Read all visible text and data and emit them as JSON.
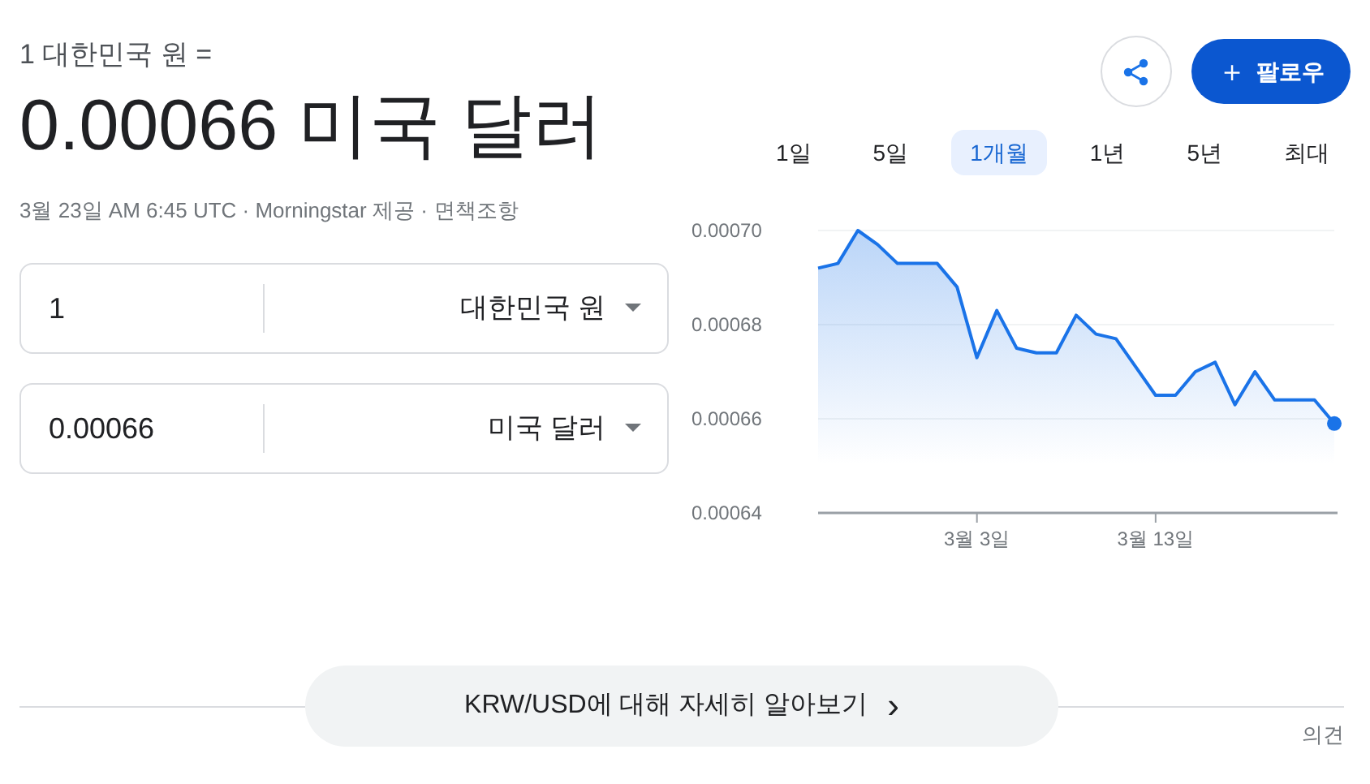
{
  "header": {
    "subtitle": "1 대한민국 원 =",
    "result": "0.00066 미국 달러",
    "meta": "3월 23일 AM 6:45 UTC · Morningstar 제공 · ",
    "disclaimer_link": "면책조항"
  },
  "follow_button": {
    "icon": "＋",
    "label": "팔로우"
  },
  "converter": [
    {
      "amount": "1",
      "currency": "대한민국 원"
    },
    {
      "amount": "0.00066",
      "currency": "미국 달러"
    }
  ],
  "range_tabs": [
    {
      "label": "1일",
      "selected": false
    },
    {
      "label": "5일",
      "selected": false
    },
    {
      "label": "1개월",
      "selected": true
    },
    {
      "label": "1년",
      "selected": false
    },
    {
      "label": "5년",
      "selected": false
    },
    {
      "label": "최대",
      "selected": false
    }
  ],
  "chart_data": {
    "type": "area",
    "categories": [
      null,
      null,
      null,
      null,
      null,
      null,
      null,
      null,
      "3월 3일",
      null,
      null,
      null,
      null,
      null,
      null,
      null,
      null,
      "3월 13일",
      null,
      null,
      null,
      null,
      null,
      null,
      null,
      null,
      null
    ],
    "series": [
      {
        "color": "#1a73e8",
        "values": [
          0.000692,
          0.000693,
          0.0007,
          0.000697,
          0.000693,
          0.000693,
          0.000693,
          0.000688,
          0.000673,
          0.000683,
          0.000675,
          0.000674,
          0.000674,
          0.000682,
          0.000678,
          0.000677,
          0.000671,
          0.000665,
          0.000665,
          0.00067,
          0.000672,
          0.000663,
          0.00067,
          0.000664,
          0.000664,
          0.000664,
          0.000659
        ]
      }
    ],
    "ylim": [
      0.00064,
      0.0007
    ],
    "yticks": [
      {
        "value": 0.0007,
        "label": "0.00070"
      },
      {
        "value": 0.00068,
        "label": "0.00068"
      },
      {
        "value": 0.00066,
        "label": "0.00066"
      },
      {
        "value": 0.00064,
        "label": "0.00064"
      }
    ]
  },
  "more_button": {
    "label": "KRW/USD에 대해 자세히 알아보기",
    "icon": "›"
  },
  "feedback": "의견"
}
